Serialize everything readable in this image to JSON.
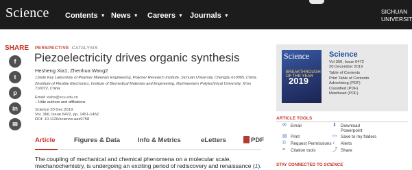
{
  "header": {
    "logo": "Science",
    "nav": [
      {
        "label": "Contents"
      },
      {
        "label": "News"
      },
      {
        "label": "Careers"
      },
      {
        "label": "Journals"
      }
    ],
    "institution_line1": "SICHUAN",
    "institution_line2": "UNIVERSITY"
  },
  "share": {
    "label": "SHARE",
    "buttons": [
      {
        "icon": "facebook-icon",
        "glyph": "f"
      },
      {
        "icon": "twitter-icon",
        "glyph": "t"
      },
      {
        "icon": "pinterest-icon",
        "glyph": "p"
      },
      {
        "icon": "linkedin-icon",
        "glyph": "in"
      },
      {
        "icon": "email-icon",
        "glyph": "✉"
      }
    ]
  },
  "article": {
    "kicker": "PERSPECTIVE",
    "category": "CATALYSIS",
    "title": "Piezoelectricity drives organic synthesis",
    "authors": "Hesheng Xia1, Zhenhua Wang2",
    "affiliation1": "1State Key Laboratory of Polymer Materials Engineering, Polymer Research Institute, Sichuan University, Chengdu 610065, China.",
    "affiliation2a": "2Institute of Flexible Electronics, Institute of Biomedical Materials and Engineering, Northwestern Polytechnical University, Xi'an",
    "affiliation2b": "710072, China.",
    "email_label": "Email:",
    "email": "xiahs@scu.edu.cn",
    "hide_affiliations": "– Hide authors and affiliations",
    "journal": "Science",
    "date": "20 Dec 2019:",
    "volume": "Vol. 366, Issue 6472, pp. 1451-1452",
    "doi": "DOI: 10.1126/science.aaz9758"
  },
  "tabs": {
    "article": "Article",
    "figures": "Figures & Data",
    "info": "Info & Metrics",
    "eletters": "eLetters",
    "pdf": "PDF"
  },
  "body": {
    "line1": "The coupling of mechanical and chemical phenomena on a molecular scale,",
    "line2": "mechanochemistry, is undergoing an exciting period of rediscovery and renaissance (",
    "ref": "1",
    "line2_end": ")."
  },
  "issue": {
    "cover_word": "Science",
    "cover_subtitle": "BREAKTHROUGH OF THE YEAR",
    "cover_year": "2019",
    "title": "Science",
    "vol": "Vol 366, Issue 6472",
    "date": "20 December 2019",
    "links": [
      "Table of Contents",
      "Print Table of Contents",
      "Advertising (PDF)",
      "Classified (PDF)",
      "Masthead (PDF)"
    ]
  },
  "tools": {
    "heading": "ARTICLE TOOLS",
    "email": "Email",
    "print": "Print",
    "permissions": "Request Permissions",
    "citation": "Citation tools",
    "download1": "Download",
    "download2": "Powerpoint",
    "save": "Save to my folders",
    "alerts": "Alerts",
    "share": "Share"
  },
  "stay": {
    "prefix": "STAY CONNECTED TO ",
    "brand": "SCIENCE"
  }
}
